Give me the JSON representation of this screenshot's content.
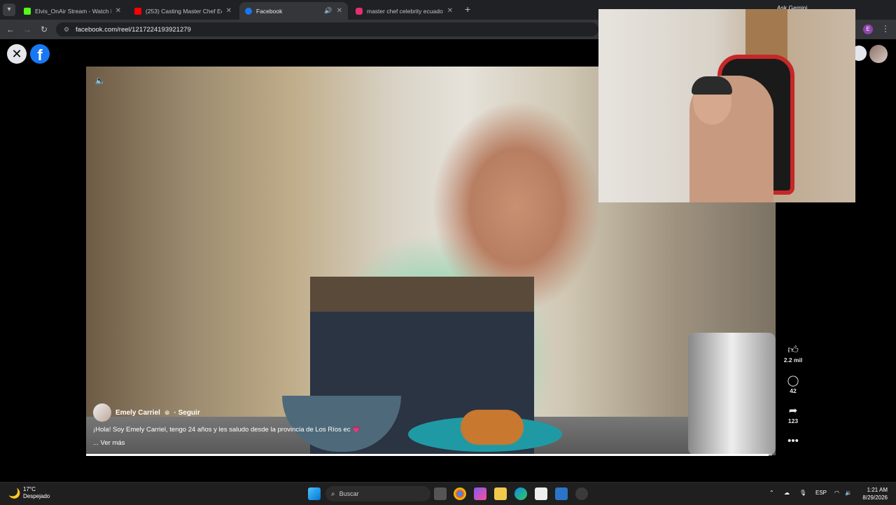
{
  "browser": {
    "tabs": [
      {
        "title": "Elvis_OnAir Stream - Watch Live",
        "favicon_color": "#53fc18",
        "active": false
      },
      {
        "title": "(253) Casting Master Chef Ecua",
        "favicon_color": "#ff0000",
        "active": false
      },
      {
        "title": "Facebook",
        "favicon_color": "#1877f2",
        "active": true
      },
      {
        "title": "master chef celebrity ecuador -",
        "favicon_color": "#e1306c",
        "active": false
      }
    ],
    "ask_gemini": "Ask Gemini",
    "url": "facebook.com/reel/1217224193921279",
    "profile_initial": "E"
  },
  "facebook": {
    "close_icon": "close-icon",
    "logo_letter": "f"
  },
  "reel": {
    "author": "Emely Carriel",
    "follow_label": "· Seguir",
    "caption": "¡Hola! Soy Emely Carriel, tengo 24 años y les saludo desde la provincia de Los Ríos ec 💗",
    "see_more": "... Ver más",
    "progress_fraction": 0.995,
    "actions": {
      "likes": "2.2 mil",
      "comments": "42",
      "shares": "123"
    }
  },
  "taskbar": {
    "temperature": "17°C",
    "weather_desc": "Despejado",
    "search_placeholder": "Buscar",
    "language": "ESP",
    "time": "1:21 AM",
    "date": "8/29/2026"
  }
}
